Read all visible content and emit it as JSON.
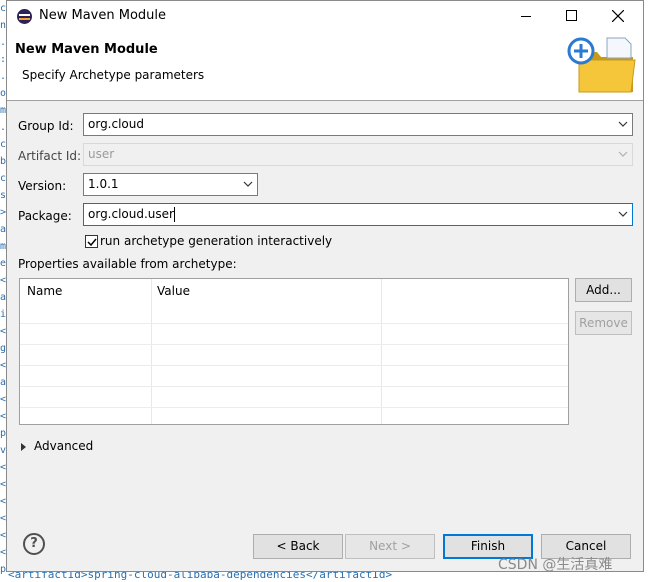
{
  "window": {
    "title": "New Maven Module"
  },
  "banner": {
    "title": "New Maven Module",
    "description": "Specify Archetype parameters"
  },
  "form": {
    "group_id_label": "Group Id:",
    "group_id_value": "org.cloud",
    "artifact_id_label": "Artifact Id:",
    "artifact_id_value": "user",
    "version_label": "Version:",
    "version_value": "1.0.1",
    "package_label": "Package:",
    "package_value": "org.cloud.user",
    "interactive_label": "run archetype generation interactively",
    "interactive_checked": true
  },
  "properties": {
    "label": "Properties available from archetype:",
    "columns": [
      "Name",
      "Value"
    ],
    "rows": []
  },
  "side_buttons": {
    "add": "Add...",
    "remove": "Remove"
  },
  "advanced": {
    "label": "Advanced"
  },
  "footer": {
    "help": "?",
    "back": "< Back",
    "next": "Next >",
    "finish": "Finish",
    "cancel": "Cancel"
  },
  "background_text": {
    "left_chars": [
      "c",
      "n",
      ".",
      ":",
      ".",
      "o",
      "m",
      ".",
      "c",
      "b",
      "c",
      "s",
      ">",
      "a",
      "m",
      "e",
      "<",
      "a",
      "i",
      "<",
      "g",
      "<",
      "a",
      "<",
      "<",
      "p",
      "v",
      "<",
      "<",
      "<",
      "<",
      "<",
      "<",
      "p",
      "<"
    ],
    "bottom_line": "<artifactId>spring-cloud-alibaba-dependencies</artifactId>"
  },
  "watermark": "CSDN @生活真难",
  "colors": {
    "focus_border": "#0078d7",
    "dialog_bg": "#f0f0f0",
    "disabled_text": "#a0a0a0"
  },
  "icons": {
    "app": "eclipse-icon",
    "banner": "new-folder-plus-icon"
  }
}
